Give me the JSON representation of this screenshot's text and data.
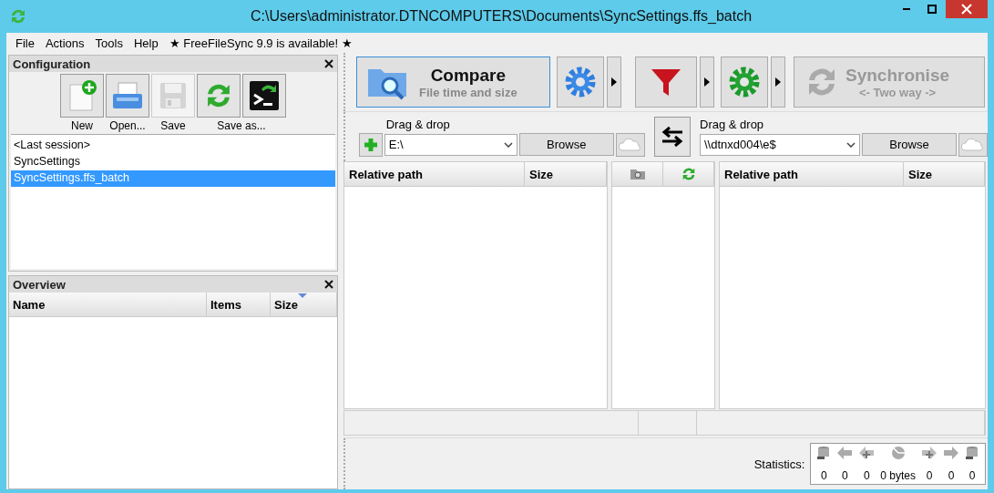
{
  "window": {
    "title": "C:\\Users\\administrator.DTNCOMPUTERS\\Documents\\SyncSettings.ffs_batch"
  },
  "menu": [
    {
      "label": "File"
    },
    {
      "label": "Actions"
    },
    {
      "label": "Tools"
    },
    {
      "label": "Help"
    }
  ],
  "update_notice": "★ FreeFileSync 9.9 is available! ★",
  "configuration": {
    "title": "Configuration",
    "tools": [
      {
        "kind": "new",
        "disabled": false
      },
      {
        "kind": "open",
        "disabled": false
      },
      {
        "kind": "save",
        "disabled": true
      },
      {
        "kind": "save-as",
        "disabled": false
      },
      {
        "kind": "save-as-batch",
        "disabled": false
      }
    ],
    "tool_labels": [
      {
        "label": "New"
      },
      {
        "label": "Open..."
      },
      {
        "label": "Save"
      },
      {
        "label": "Save as..."
      }
    ],
    "items": [
      {
        "name": "<Last session>",
        "selected": false
      },
      {
        "name": "SyncSettings",
        "selected": false
      },
      {
        "name": "SyncSettings.ffs_batch",
        "selected": true
      }
    ]
  },
  "overview": {
    "title": "Overview",
    "columns": [
      {
        "label": "Name",
        "sorted": false
      },
      {
        "label": "Items",
        "sorted": false
      },
      {
        "label": "Size",
        "sorted": true
      }
    ]
  },
  "compare": {
    "title": "Compare",
    "subtitle": "File time and size"
  },
  "synchronise": {
    "title": "Synchronise",
    "subtitle": "<- Two way ->",
    "disabled": true
  },
  "folders": [
    {
      "label": "Drag & drop",
      "value": "E:\\",
      "browse": "Browse"
    },
    {
      "label": "Drag & drop",
      "value": "\\\\dtnxd004\\e$",
      "browse": "Browse"
    }
  ],
  "left_grid": {
    "columns": [
      "Relative path",
      "Size"
    ]
  },
  "right_grid": {
    "columns": [
      "Relative path",
      "Size"
    ]
  },
  "statistics": {
    "label": "Statistics:",
    "items": [
      {
        "kind": "delete-left",
        "value": "0"
      },
      {
        "kind": "overwrite-left",
        "value": "0"
      },
      {
        "kind": "create-left",
        "value": "0"
      },
      {
        "kind": "data",
        "value": "0 bytes"
      },
      {
        "kind": "create-right",
        "value": "0"
      },
      {
        "kind": "overwrite-right",
        "value": "0"
      },
      {
        "kind": "delete-right",
        "value": "0"
      }
    ]
  }
}
